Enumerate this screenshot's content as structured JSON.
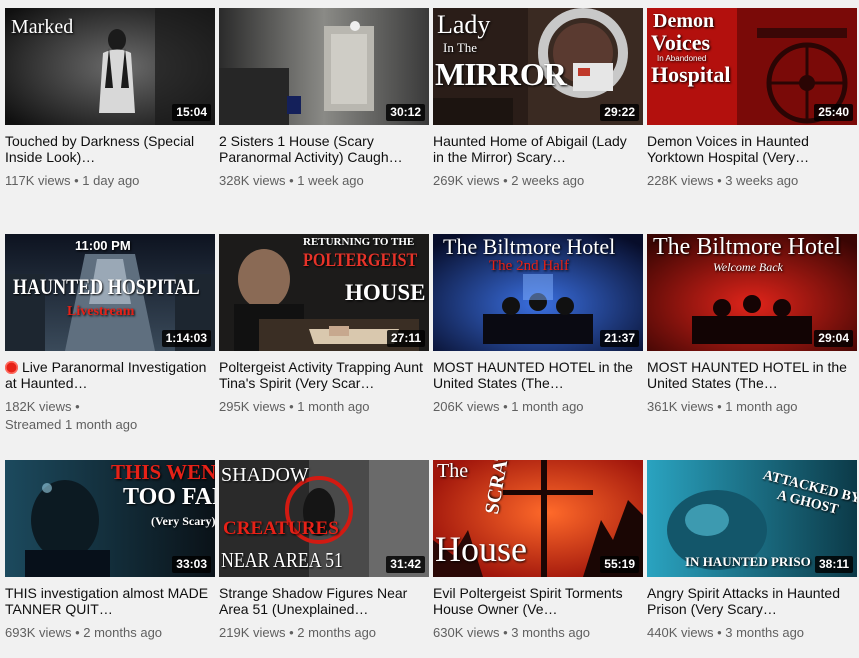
{
  "videos": [
    {
      "title": "Touched by Darkness (Special Inside Look)…",
      "views": "117K views",
      "age": "1 day ago",
      "duration": "15:04",
      "overlay": [
        "Marked"
      ]
    },
    {
      "title": "2 Sisters 1 House (Scary Paranormal Activity) Caugh…",
      "views": "328K views",
      "age": "1 week ago",
      "duration": "30:12",
      "overlay": []
    },
    {
      "title": "Haunted Home of Abigail (Lady in the Mirror) Scary…",
      "views": "269K views",
      "age": "2 weeks ago",
      "duration": "29:22",
      "overlay": [
        "Lady",
        "In The",
        "MIRROR"
      ]
    },
    {
      "title": "Demon Voices in Haunted Yorktown Hospital (Very…",
      "views": "228K views",
      "age": "3 weeks ago",
      "duration": "25:40",
      "overlay": [
        "Demon",
        "Voices",
        "In Abandoned",
        "Hospital"
      ]
    },
    {
      "title": "Live Paranormal Investigation at Haunted…",
      "views": "182K views",
      "age": "Streamed 1 month ago",
      "duration": "1:14:03",
      "live": true,
      "overlay": [
        "11:00 PM",
        "HAUNTED HOSPITAL",
        "Livestream"
      ]
    },
    {
      "title": "Poltergeist Activity Trapping Aunt Tina's Spirit (Very Scar…",
      "views": "295K views",
      "age": "1 month ago",
      "duration": "27:11",
      "overlay": [
        "RETURNING TO THE",
        "POLTERGEIST",
        "HOUSE"
      ]
    },
    {
      "title": "MOST HAUNTED HOTEL in the United States (The…",
      "views": "206K views",
      "age": "1 month ago",
      "duration": "21:37",
      "overlay": [
        "The Biltmore Hotel",
        "The 2nd Half"
      ]
    },
    {
      "title": "MOST HAUNTED HOTEL in the United States (The…",
      "views": "361K views",
      "age": "1 month ago",
      "duration": "29:04",
      "overlay": [
        "The Biltmore Hotel",
        "Welcome Back"
      ]
    },
    {
      "title": "THIS investigation almost MADE TANNER QUIT…",
      "views": "693K views",
      "age": "2 months ago",
      "duration": "33:03",
      "overlay": [
        "THIS WENT",
        "TOO FAR",
        "(Very Scary)"
      ]
    },
    {
      "title": "Strange Shadow Figures Near Area 51 (Unexplained…",
      "views": "219K views",
      "age": "2 months ago",
      "duration": "31:42",
      "overlay": [
        "SHADOW",
        "CREATURES",
        "NEAR AREA 51"
      ]
    },
    {
      "title": "Evil Poltergeist Spirit Torments House Owner (Ve…",
      "views": "630K views",
      "age": "3 months ago",
      "duration": "55:19",
      "overlay": [
        "The",
        "SCRATCH",
        "House"
      ]
    },
    {
      "title": "Angry Spirit Attacks in Haunted Prison (Very Scary…",
      "views": "440K views",
      "age": "3 months ago",
      "duration": "38:11",
      "overlay": [
        "ATTACKED BY",
        "A GHOST",
        "IN HAUNTED PRISO"
      ]
    }
  ],
  "separator": " • ",
  "colors": {
    "live": "#e62117",
    "meta": "#606060",
    "background": "#f1f1f1"
  }
}
